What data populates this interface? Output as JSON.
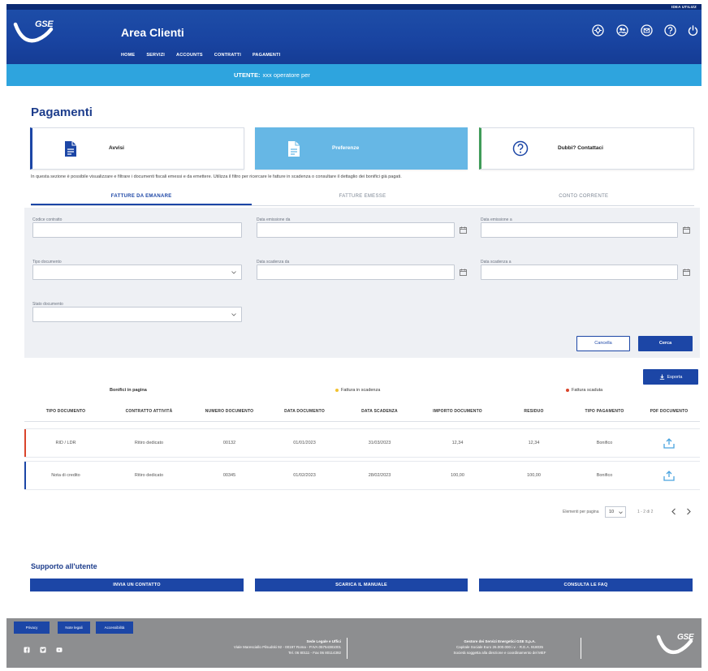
{
  "colors": {
    "primary": "#1c46a6",
    "header": "#1944a1",
    "banner": "#2ea4de",
    "card_highlight": "#66b7e5",
    "fattura_scaduta": "#d9442b",
    "fattura_in_scadenza": "#f2c230",
    "footer": "#8d8e90"
  },
  "header": {
    "top_text": "IDEA UTILIZZ",
    "logo_text": "GSE",
    "app_title": "Area Clienti",
    "nav": [
      "HOME",
      "SERVIZI",
      "ACCOUNTS",
      "CONTRATTI",
      "PAGAMENTI"
    ],
    "icons": [
      "settings-icon",
      "users-icon",
      "mail-icon",
      "help-icon",
      "power-icon"
    ]
  },
  "banner": {
    "label": "UTENTE:",
    "value": "xxx operatore per"
  },
  "page_title": "Pagamenti",
  "cards": [
    {
      "label": "Avvisi",
      "icon": "document-icon"
    },
    {
      "label": "Preferenze",
      "icon": "document-icon",
      "active": true
    },
    {
      "label": "Dubbi? Contattaci",
      "icon": "question-icon"
    }
  ],
  "info_text": "In questa sezione è possibile visualizzare e filtrare i documenti fiscali emessi e da emettere. Utilizza il filtro per ricercare le fatture in scadenza o consultare il dettaglio dei bonifici già pagati.",
  "tabs": [
    "FATTURE DA EMANARE",
    "FATTURE EMESSE",
    "CONTO CORRENTE"
  ],
  "active_tab": 0,
  "filters": {
    "fields": [
      {
        "label": "Codice contratto",
        "type": "text",
        "value": ""
      },
      {
        "label": "Data emissione da",
        "type": "date",
        "value": ""
      },
      {
        "label": "Data emissione a",
        "type": "date",
        "value": ""
      },
      {
        "label": "Tipo documento",
        "type": "select",
        "value": ""
      },
      {
        "label": "Data scadenza da",
        "type": "date",
        "value": ""
      },
      {
        "label": "Data scadenza a",
        "type": "date",
        "value": ""
      },
      {
        "label": "Stato documento",
        "type": "select",
        "value": ""
      }
    ],
    "cancel_label": "Cancella",
    "search_label": "Cerca"
  },
  "export_label": "Esporta",
  "legend": {
    "paged": "Bonifici in pagina",
    "in_scadenza": "Fattura in scadenza",
    "scaduta": "Fattura scaduta"
  },
  "table": {
    "columns": [
      "TIPO DOCUMENTO",
      "CONTRATTO ATTIVITÀ",
      "NUMERO DOCUMENTO",
      "DATA DOCUMENTO",
      "DATA SCADENZA",
      "IMPORTO DOCUMENTO",
      "RESIDUO",
      "TIPO PAGAMENTO",
      "PDF DOCUMENTO"
    ],
    "rows": [
      {
        "accent": "#d9442b",
        "cells": [
          "RID / LDR",
          "Ritiro dedicato",
          "00132",
          "01/01/2023",
          "31/03/2023",
          "12,34",
          "12,34",
          "Bonifico"
        ]
      },
      {
        "accent": "#1c46a6",
        "cells": [
          "Nota di credito",
          "Ritiro dedicato",
          "00345",
          "01/02/2023",
          "28/02/2023",
          "100,00",
          "100,00",
          "Bonifico"
        ]
      }
    ]
  },
  "pagination": {
    "per_page_label": "Elementi per pagina",
    "per_page_value": "10",
    "range": "1 - 2 di 2"
  },
  "support": {
    "title": "Supporto all'utente",
    "buttons": [
      "INVIA UN CONTATTO",
      "SCARICA IL MANUALE",
      "CONSULTA LE FAQ"
    ]
  },
  "footer": {
    "links": [
      "Privacy",
      "Note legali",
      "Accessibilità"
    ],
    "socials": [
      "facebook-icon",
      "twitter-icon",
      "youtube-icon"
    ],
    "block1": [
      "Sede Legale e Uffici",
      "Viale Maresciallo Pilsudski 92 - 00197 Roma - P.IVA 05754381001",
      "Tel. 06 80111 - Fax 06 80114392"
    ],
    "block2": [
      "Gestore dei Servizi Energetici GSE S.p.A.",
      "Capitale Sociale Euro 26.000.000 i.v. - R.E.A. 918035",
      "Società soggetta alla direzione e coordinamento del MEF"
    ],
    "logo_text": "GSE"
  }
}
